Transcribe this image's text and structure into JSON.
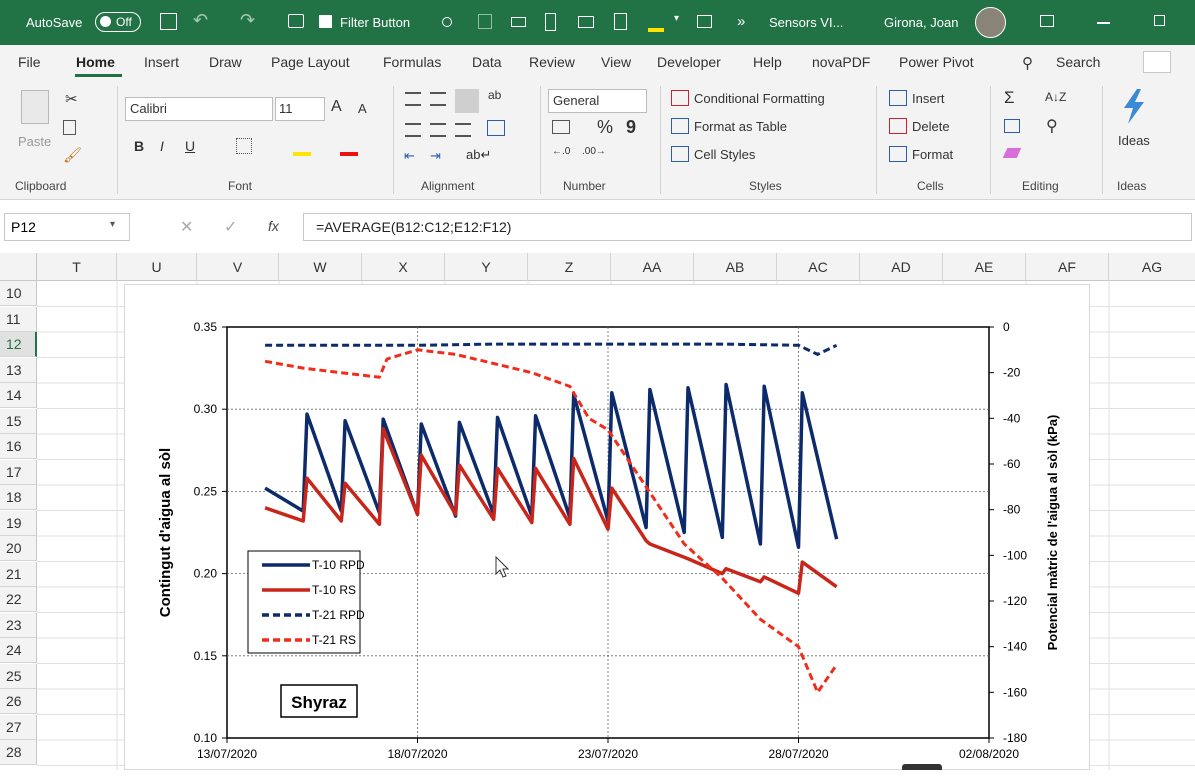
{
  "titlebar": {
    "autosave_label": "AutoSave",
    "autosave_state": "Off",
    "filter_button": "Filter Button",
    "file_title": "Sensors VI...",
    "user_name": "Girona, Joan",
    "chevron": "»"
  },
  "tabs": [
    "File",
    "Home",
    "Insert",
    "Draw",
    "Page Layout",
    "Formulas",
    "Data",
    "Review",
    "View",
    "Developer",
    "Help",
    "novaPDF",
    "Power Pivot"
  ],
  "active_tab": "Home",
  "search_label": "Search",
  "ribbon": {
    "clipboard": {
      "paste": "Paste",
      "group": "Clipboard"
    },
    "font": {
      "name": "Calibri",
      "size": "11",
      "grow": "A",
      "shrink": "A",
      "bold": "B",
      "italic": "I",
      "underline": "U",
      "group": "Font"
    },
    "alignment": {
      "group": "Alignment"
    },
    "number": {
      "format": "General",
      "percent": "%",
      "comma": "9",
      "group": "Number"
    },
    "styles": {
      "conditional": "Conditional Formatting",
      "table": "Format as Table",
      "cell_styles": "Cell Styles",
      "group": "Styles"
    },
    "cells": {
      "insert": "Insert",
      "delete": "Delete",
      "format": "Format",
      "group": "Cells"
    },
    "editing": {
      "group": "Editing"
    },
    "ideas": {
      "label": "Ideas",
      "group": "Ideas"
    }
  },
  "formula_bar": {
    "name_box": "P12",
    "fx": "fx",
    "formula": "=AVERAGE(B12:C12;E12:F12)"
  },
  "columns": [
    "T",
    "U",
    "V",
    "W",
    "X",
    "Y",
    "Z",
    "AA",
    "AB",
    "AC",
    "AD",
    "AE",
    "AF",
    "AG"
  ],
  "rows": [
    "10",
    "11",
    "12",
    "13",
    "14",
    "15",
    "16",
    "17",
    "18",
    "19",
    "20",
    "21",
    "22",
    "23",
    "24",
    "25",
    "26",
    "27",
    "28"
  ],
  "active_row": "12",
  "colors": {
    "ribbon_green": "#217346",
    "navy": "#0d2a6b",
    "red": "#d9281a",
    "red_dash": "#f02d1b"
  },
  "chart_data": {
    "type": "line",
    "ylabel": "Contingut d'aigua al sòl",
    "y2label": "Potencial màtric de l'aigua al sòl (kPa)",
    "annotation": "Shyraz",
    "x_ticks": [
      "13/07/2020",
      "18/07/2020",
      "23/07/2020",
      "28/07/2020",
      "02/08/2020"
    ],
    "ylim": [
      0.1,
      0.35
    ],
    "y_ticks": [
      "0.10",
      "0.15",
      "0.20",
      "0.25",
      "0.30",
      "0.35"
    ],
    "y2lim": [
      -180,
      0
    ],
    "y2_ticks": [
      "0",
      "-20",
      "-40",
      "-60",
      "-80",
      "-100",
      "-120",
      "-140",
      "-160",
      "-180"
    ],
    "grid": true,
    "legend_position": "bottom-left",
    "series": [
      {
        "name": "T-10 RPD",
        "axis": "left",
        "style": "solid",
        "color": "#0d2a6b",
        "x": [
          "2020-07-14",
          "2020-07-15",
          "2020-07-15.1",
          "2020-07-16",
          "2020-07-16.1",
          "2020-07-17",
          "2020-07-17.1",
          "2020-07-18",
          "2020-07-18.1",
          "2020-07-19",
          "2020-07-19.1",
          "2020-07-20",
          "2020-07-20.1",
          "2020-07-21",
          "2020-07-21.1",
          "2020-07-22",
          "2020-07-22.1",
          "2020-07-23",
          "2020-07-23.1",
          "2020-07-24",
          "2020-07-24.1",
          "2020-07-25",
          "2020-07-25.1",
          "2020-07-26",
          "2020-07-26.1",
          "2020-07-27",
          "2020-07-27.1",
          "2020-07-28",
          "2020-07-28.1",
          "2020-07-29"
        ],
        "values": [
          0.252,
          0.238,
          0.297,
          0.238,
          0.293,
          0.237,
          0.294,
          0.236,
          0.291,
          0.235,
          0.292,
          0.236,
          0.295,
          0.235,
          0.296,
          0.234,
          0.309,
          0.232,
          0.31,
          0.228,
          0.312,
          0.225,
          0.313,
          0.222,
          0.315,
          0.218,
          0.314,
          0.216,
          0.31,
          0.221
        ]
      },
      {
        "name": "T-10 RS",
        "axis": "left",
        "style": "solid",
        "color": "#c8261b",
        "x": [
          "2020-07-14",
          "2020-07-15",
          "2020-07-15.1",
          "2020-07-16",
          "2020-07-16.1",
          "2020-07-17",
          "2020-07-17.1",
          "2020-07-18",
          "2020-07-18.1",
          "2020-07-19",
          "2020-07-19.1",
          "2020-07-20",
          "2020-07-20.1",
          "2020-07-21",
          "2020-07-21.1",
          "2020-07-22",
          "2020-07-22.1",
          "2020-07-23",
          "2020-07-23.1",
          "2020-07-24",
          "2020-07-24.1",
          "2020-07-25",
          "2020-07-25.1",
          "2020-07-26",
          "2020-07-26.1",
          "2020-07-27",
          "2020-07-27.1",
          "2020-07-28",
          "2020-07-28.1",
          "2020-07-29"
        ],
        "values": [
          0.24,
          0.232,
          0.258,
          0.232,
          0.255,
          0.23,
          0.288,
          0.236,
          0.272,
          0.236,
          0.266,
          0.233,
          0.264,
          0.231,
          0.264,
          0.23,
          0.27,
          0.227,
          0.252,
          0.22,
          0.218,
          0.21,
          0.209,
          0.2,
          0.203,
          0.195,
          0.198,
          0.188,
          0.207,
          0.192
        ]
      },
      {
        "name": "T-21 RPD",
        "axis": "right",
        "style": "dashed",
        "color": "#0d2a6b",
        "x": [
          "2020-07-14",
          "2020-07-16",
          "2020-07-18",
          "2020-07-20",
          "2020-07-22",
          "2020-07-24",
          "2020-07-26",
          "2020-07-28",
          "2020-07-28.5",
          "2020-07-29"
        ],
        "values": [
          -8,
          -8,
          -8,
          -7.5,
          -7.5,
          -7.5,
          -7.5,
          -8,
          -12,
          -8
        ]
      },
      {
        "name": "T-21 RS",
        "axis": "right",
        "style": "dashed",
        "color": "#f02d1b",
        "x": [
          "2020-07-14",
          "2020-07-15",
          "2020-07-16",
          "2020-07-17",
          "2020-07-17.2",
          "2020-07-18",
          "2020-07-19",
          "2020-07-20",
          "2020-07-21",
          "2020-07-22",
          "2020-07-22.5",
          "2020-07-23",
          "2020-07-24",
          "2020-07-25",
          "2020-07-26",
          "2020-07-27",
          "2020-07-28",
          "2020-07-28.5",
          "2020-07-29"
        ],
        "values": [
          -15,
          -18,
          -20,
          -22,
          -14,
          -10,
          -12,
          -16,
          -20,
          -26,
          -40,
          -45,
          -70,
          -95,
          -110,
          -128,
          -140,
          -160,
          -148
        ]
      }
    ]
  }
}
